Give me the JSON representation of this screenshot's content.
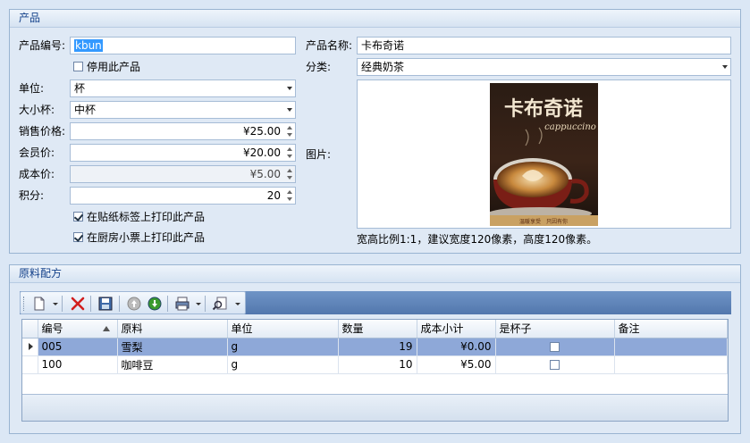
{
  "product": {
    "group_title": "产品",
    "code_label": "产品编号:",
    "code_value": "kbun",
    "disable_label": "停用此产品",
    "disable_checked": false,
    "unit_label": "单位:",
    "unit_value": "杯",
    "size_label": "大小杯:",
    "size_value": "中杯",
    "price_label": "销售价格:",
    "price_value": "¥25.00",
    "member_label": "会员价:",
    "member_value": "¥20.00",
    "cost_label": "成本价:",
    "cost_value": "¥5.00",
    "points_label": "积分:",
    "points_value": "20",
    "print_sticker_label": "在贴纸标签上打印此产品",
    "print_sticker_checked": true,
    "print_kitchen_label": "在厨房小票上打印此产品",
    "print_kitchen_checked": true,
    "name_label": "产品名称:",
    "name_value": "卡布奇诺",
    "category_label": "分类:",
    "category_value": "经典奶茶",
    "image_label": "图片:",
    "image_hint": "宽高比例1:1，建议宽度120像素，高度120像素。",
    "poster": {
      "title": "卡布奇诺",
      "subtitle": "cappuccino",
      "bottom": "温暖享受　只因有你"
    }
  },
  "recipe": {
    "group_title": "原料配方",
    "toolbar": [
      "new-icon",
      "delete-icon",
      "save-icon",
      "move-up-icon",
      "move-down-icon",
      "print-icon",
      "find-icon"
    ],
    "columns": [
      "编号",
      "原料",
      "单位",
      "数量",
      "成本小计",
      "是杯子",
      "备注"
    ],
    "rows": [
      {
        "code": "005",
        "material": "雪梨",
        "unit": "g",
        "qty": "19",
        "cost": "¥0.00",
        "is_cup": false,
        "note": ""
      },
      {
        "code": "100",
        "material": "咖啡豆",
        "unit": "g",
        "qty": "10",
        "cost": "¥5.00",
        "is_cup": false,
        "note": ""
      }
    ]
  },
  "colors": {
    "accent": "#15428b",
    "selected_row": "#8ea8d8",
    "toolbar_bg": "#5a7fb5"
  }
}
